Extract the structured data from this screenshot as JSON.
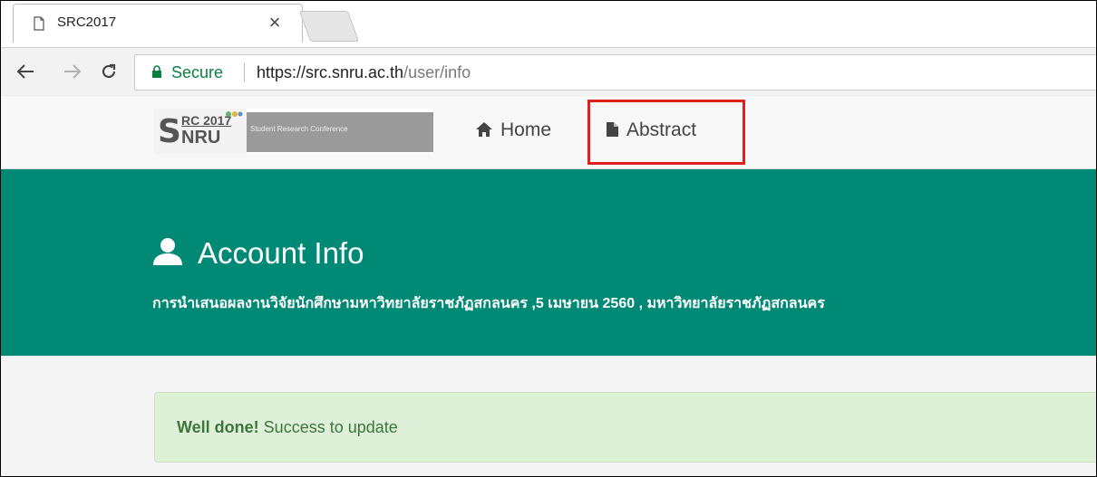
{
  "browser": {
    "tab_title": "SRC2017",
    "close_glyph": "×",
    "secure_label": "Secure",
    "url_host": "https://src.snru.ac.th",
    "url_path": "/user/info"
  },
  "navbar": {
    "logo": {
      "mark_s": "S",
      "mark_rc": "RC 2017",
      "mark_nru": "NRU",
      "band_text": "Student Research Conference"
    },
    "home_label": "Home",
    "abstract_label": "Abstract"
  },
  "hero": {
    "title": "Account Info",
    "subtitle": "การนำเสนอผลงานวิจัยนักศึกษามหาวิทยาลัยราชภัฏสกลนคร ,5 เมษายน 2560 , มหาวิทยาลัยราชภัฏสกลนคร"
  },
  "alert": {
    "strong": "Well done!",
    "message": " Success to update"
  },
  "colors": {
    "hero_bg": "#008975",
    "alert_bg": "#dff0d8",
    "alert_text": "#3c763d",
    "secure_green": "#0b8043",
    "highlight_red": "#e02020"
  },
  "icons": {
    "tab": "page-icon",
    "back": "arrow-left-icon",
    "forward": "arrow-right-icon",
    "reload": "reload-icon",
    "lock": "lock-icon",
    "home": "home-icon",
    "abstract": "file-icon",
    "user": "user-icon"
  }
}
